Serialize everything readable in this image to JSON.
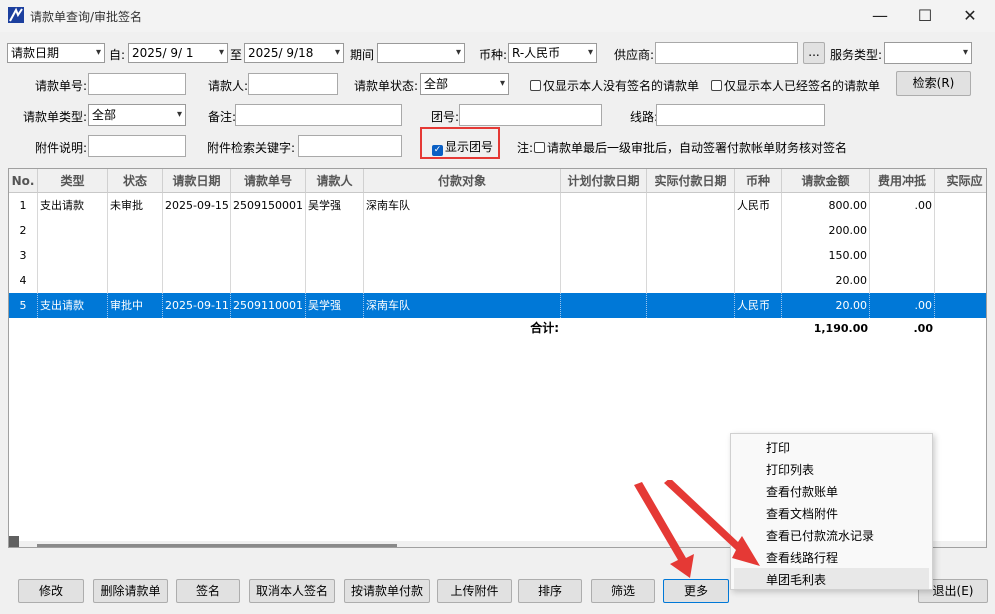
{
  "window": {
    "title": "请款单查询/审批签名",
    "minimize_glyph": "—",
    "maximize_glyph": "☐",
    "close_glyph": "✕"
  },
  "filters": {
    "date_type": "请款日期",
    "from_label": "自:",
    "from_date": "2025/ 9/ 1",
    "to_label": "至",
    "to_date": "2025/ 9/18",
    "period_label": "期间",
    "period_value": "",
    "currency_label": "币种:",
    "currency_value": "R-人民币",
    "supplier_label": "供应商:",
    "supplier_btn": "...",
    "service_type_label": "服务类型:",
    "request_no_label": "请款单号:",
    "requester_label": "请款人:",
    "status_label": "请款单状态:",
    "status_value": "全部",
    "only_unsigned_label": "仅显示本人没有签名的请款单",
    "only_signed_label": "仅显示本人已经签名的请款单",
    "search_btn": "检索(R)",
    "request_type_label": "请款单类型:",
    "request_type_value": "全部",
    "remark_label": "备注:",
    "group_no_label": "团号:",
    "route_label": "线路:",
    "attach_desc_label": "附件说明:",
    "attach_keyword_label": "附件检索关键字:",
    "show_group_label": "显示团号",
    "note_label": "注:",
    "note_text": "请款单最后一级审批后，自动签署付款帐单财务核对签名"
  },
  "table": {
    "headers": [
      "No.",
      "类型",
      "状态",
      "请款日期",
      "请款单号",
      "请款人",
      "付款对象",
      "计划付款日期",
      "实际付款日期",
      "币种",
      "请款金额",
      "费用冲抵",
      "实际应"
    ],
    "rows": [
      [
        "1",
        "支出请款",
        "未审批",
        "2025-09-15",
        "2509150001",
        "吴学强",
        "深南车队",
        "",
        "",
        "人民币",
        "800.00",
        ".00",
        ""
      ],
      [
        "2",
        "",
        "",
        "",
        "",
        "",
        "",
        "",
        "",
        "",
        "200.00",
        "",
        ""
      ],
      [
        "3",
        "",
        "",
        "",
        "",
        "",
        "",
        "",
        "",
        "",
        "150.00",
        "",
        ""
      ],
      [
        "4",
        "",
        "",
        "",
        "",
        "",
        "",
        "",
        "",
        "",
        "20.00",
        "",
        ""
      ],
      [
        "5",
        "支出请款",
        "审批中",
        "2025-09-11",
        "2509110001",
        "吴学强",
        "深南车队",
        "",
        "",
        "人民币",
        "20.00",
        ".00",
        ""
      ]
    ],
    "total_label": "合计:",
    "total_amount": "1,190.00",
    "total_offset": ".00",
    "total_tail": ":"
  },
  "context_menu": [
    "打印",
    "打印列表",
    "查看付款账单",
    "查看文档附件",
    "查看已付款流水记录",
    "查看线路行程",
    "单团毛利表"
  ],
  "toolbar": {
    "modify": "修改",
    "delete": "删除请款单",
    "sign": "签名",
    "cancel_sign": "取消本人签名",
    "pay": "按请款单付款",
    "upload": "上传附件",
    "sort": "排序",
    "filter": "筛选",
    "more": "更多",
    "exit": "退出(E)"
  },
  "colors": {
    "selection": "#0078d7",
    "highlight_box": "#e53935",
    "arrow": "#e53935",
    "checkbox_on": "#0a5fc4"
  }
}
